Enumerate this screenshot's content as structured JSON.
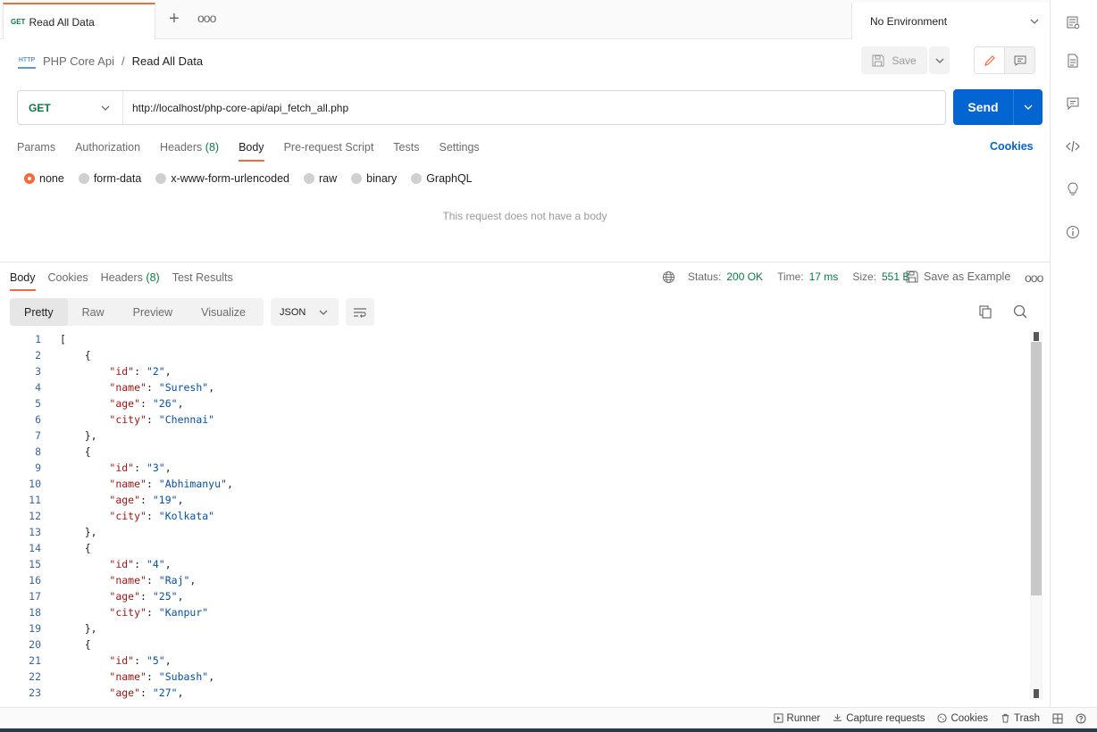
{
  "tab": {
    "method": "GET",
    "title": "Read All Data"
  },
  "environment": "No Environment",
  "breadcrumb": {
    "icon_text": "HTTP",
    "collection": "PHP Core Api",
    "separator": "/",
    "request": "Read All Data"
  },
  "toolbar": {
    "save_label": "Save"
  },
  "request": {
    "method": "GET",
    "url": "http://localhost/php-core-api/api_fetch_all.php",
    "send_label": "Send"
  },
  "request_tabs": [
    {
      "label": "Params",
      "count": ""
    },
    {
      "label": "Authorization",
      "count": ""
    },
    {
      "label": "Headers",
      "count": "(8)"
    },
    {
      "label": "Body",
      "count": ""
    },
    {
      "label": "Pre-request Script",
      "count": ""
    },
    {
      "label": "Tests",
      "count": ""
    },
    {
      "label": "Settings",
      "count": ""
    }
  ],
  "cookies_label": "Cookies",
  "body_types": [
    "none",
    "form-data",
    "x-www-form-urlencoded",
    "raw",
    "binary",
    "GraphQL"
  ],
  "no_body_text": "This request does not have a body",
  "response": {
    "tabs": [
      {
        "label": "Body",
        "count": ""
      },
      {
        "label": "Cookies",
        "count": ""
      },
      {
        "label": "Headers",
        "count": "(8)"
      },
      {
        "label": "Test Results",
        "count": ""
      }
    ],
    "status_label": "Status:",
    "status_value": "200 OK",
    "time_label": "Time:",
    "time_value": "17 ms",
    "size_label": "Size:",
    "size_value": "551 B",
    "save_example": "Save as Example",
    "view_tabs": [
      "Pretty",
      "Raw",
      "Preview",
      "Visualize"
    ],
    "format": "JSON",
    "code_lines": [
      [
        [
          "p",
          "["
        ]
      ],
      [
        [
          "p",
          "    {"
        ]
      ],
      [
        [
          "p",
          "        "
        ],
        [
          "k",
          "\"id\""
        ],
        [
          "p",
          ": "
        ],
        [
          "s",
          "\"2\""
        ],
        [
          "p",
          ","
        ]
      ],
      [
        [
          "p",
          "        "
        ],
        [
          "k",
          "\"name\""
        ],
        [
          "p",
          ": "
        ],
        [
          "s",
          "\"Suresh\""
        ],
        [
          "p",
          ","
        ]
      ],
      [
        [
          "p",
          "        "
        ],
        [
          "k",
          "\"age\""
        ],
        [
          "p",
          ": "
        ],
        [
          "s",
          "\"26\""
        ],
        [
          "p",
          ","
        ]
      ],
      [
        [
          "p",
          "        "
        ],
        [
          "k",
          "\"city\""
        ],
        [
          "p",
          ": "
        ],
        [
          "s",
          "\"Chennai\""
        ]
      ],
      [
        [
          "p",
          "    },"
        ]
      ],
      [
        [
          "p",
          "    {"
        ]
      ],
      [
        [
          "p",
          "        "
        ],
        [
          "k",
          "\"id\""
        ],
        [
          "p",
          ": "
        ],
        [
          "s",
          "\"3\""
        ],
        [
          "p",
          ","
        ]
      ],
      [
        [
          "p",
          "        "
        ],
        [
          "k",
          "\"name\""
        ],
        [
          "p",
          ": "
        ],
        [
          "s",
          "\"Abhimanyu\""
        ],
        [
          "p",
          ","
        ]
      ],
      [
        [
          "p",
          "        "
        ],
        [
          "k",
          "\"age\""
        ],
        [
          "p",
          ": "
        ],
        [
          "s",
          "\"19\""
        ],
        [
          "p",
          ","
        ]
      ],
      [
        [
          "p",
          "        "
        ],
        [
          "k",
          "\"city\""
        ],
        [
          "p",
          ": "
        ],
        [
          "s",
          "\"Kolkata\""
        ]
      ],
      [
        [
          "p",
          "    },"
        ]
      ],
      [
        [
          "p",
          "    {"
        ]
      ],
      [
        [
          "p",
          "        "
        ],
        [
          "k",
          "\"id\""
        ],
        [
          "p",
          ": "
        ],
        [
          "s",
          "\"4\""
        ],
        [
          "p",
          ","
        ]
      ],
      [
        [
          "p",
          "        "
        ],
        [
          "k",
          "\"name\""
        ],
        [
          "p",
          ": "
        ],
        [
          "s",
          "\"Raj\""
        ],
        [
          "p",
          ","
        ]
      ],
      [
        [
          "p",
          "        "
        ],
        [
          "k",
          "\"age\""
        ],
        [
          "p",
          ": "
        ],
        [
          "s",
          "\"25\""
        ],
        [
          "p",
          ","
        ]
      ],
      [
        [
          "p",
          "        "
        ],
        [
          "k",
          "\"city\""
        ],
        [
          "p",
          ": "
        ],
        [
          "s",
          "\"Kanpur\""
        ]
      ],
      [
        [
          "p",
          "    },"
        ]
      ],
      [
        [
          "p",
          "    {"
        ]
      ],
      [
        [
          "p",
          "        "
        ],
        [
          "k",
          "\"id\""
        ],
        [
          "p",
          ": "
        ],
        [
          "s",
          "\"5\""
        ],
        [
          "p",
          ","
        ]
      ],
      [
        [
          "p",
          "        "
        ],
        [
          "k",
          "\"name\""
        ],
        [
          "p",
          ": "
        ],
        [
          "s",
          "\"Subash\""
        ],
        [
          "p",
          ","
        ]
      ],
      [
        [
          "p",
          "        "
        ],
        [
          "k",
          "\"age\""
        ],
        [
          "p",
          ": "
        ],
        [
          "s",
          "\"27\""
        ],
        [
          "p",
          ","
        ]
      ]
    ]
  },
  "statusbar": [
    "Runner",
    "Capture requests",
    "Cookies",
    "Trash"
  ],
  "colors": {
    "accent": "#f26b3a",
    "send": "#0265d2",
    "get": "#0a7d43",
    "json_key": "#a31515",
    "json_string": "#0451a5"
  }
}
